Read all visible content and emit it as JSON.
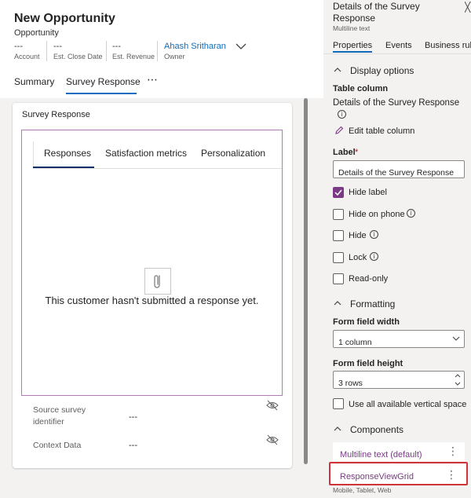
{
  "form": {
    "title": "New Opportunity",
    "entity": "Opportunity",
    "header_fields": [
      {
        "value": "---",
        "label": "Account"
      },
      {
        "value": "---",
        "label": "Est. Close Date"
      },
      {
        "value": "---",
        "label": "Est. Revenue"
      },
      {
        "value": "Ahash Sritharan",
        "label": "Owner"
      }
    ],
    "tabs": [
      "Summary",
      "Survey Response",
      "⋯"
    ],
    "active_tab": "Survey Response",
    "section_title": "Survey Response",
    "embed": {
      "tabs": [
        "Responses",
        "Satisfaction metrics",
        "Personalization"
      ],
      "empty_message": "This customer hasn't submitted a response yet."
    },
    "fields": [
      {
        "label": "Source survey identifier",
        "value": "---"
      },
      {
        "label": "Context Data",
        "value": "---"
      }
    ]
  },
  "pane": {
    "title": "Details of the Survey Response",
    "subtitle": "Multiline text",
    "tabs": [
      "Properties",
      "Events",
      "Business rule"
    ],
    "display_options": {
      "header": "Display options",
      "table_column_label": "Table column",
      "table_column_value": "Details of the Survey Response",
      "edit_label": "Edit table column",
      "label_label": "Label",
      "label_required": "*",
      "label_value": "Details of the Survey Response",
      "checkboxes": [
        {
          "label": "Hide label",
          "checked": true
        },
        {
          "label": "Hide on phone",
          "checked": false
        },
        {
          "label": "Hide",
          "checked": false
        },
        {
          "label": "Lock",
          "checked": false
        },
        {
          "label": "Read-only",
          "checked": false
        }
      ]
    },
    "formatting": {
      "header": "Formatting",
      "width_label": "Form field width",
      "width_value": "1 column",
      "height_label": "Form field height",
      "height_value": "3 rows",
      "use_all_space_label": "Use all available vertical space"
    },
    "components": {
      "header": "Components",
      "items": [
        "Multiline text (default)",
        "ResponseViewGrid"
      ],
      "footnote": "Mobile, Tablet, Web"
    }
  },
  "colors": {
    "accent_blue": "#0f6cbd",
    "purple": "#7b3a85",
    "highlight_red": "#d13438"
  }
}
